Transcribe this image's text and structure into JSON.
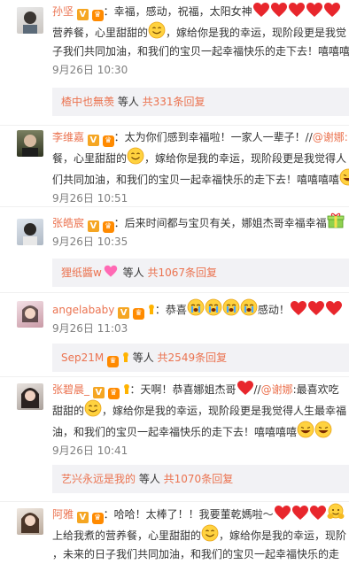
{
  "comments": [
    {
      "username": "孙坚",
      "lines": [
        "：幸福，感动，祝福，太阳女神",
        "营养餐，心里甜甜的",
        "，嫁给你是我的幸运，现阶段更是我觉",
        "子我们共同加油，和我们的宝贝一起幸福快乐的走下去！嘻嘻嘻"
      ],
      "time": "9月26日 10:30",
      "reply": {
        "who": "楂中也無羡",
        "middle": " 等人 ",
        "count": "共331条回复"
      }
    },
    {
      "username": "李维嘉",
      "lines": [
        "：太为你们感到幸福啦！一家人一辈子！//",
        "@谢娜:",
        "餐，心里甜甜的",
        "，嫁给你是我的幸运，现阶段更是我觉得人",
        "们共同加油，和我们的宝贝一起幸福快乐的走下去！嘻嘻嘻嘻"
      ],
      "time": "9月26日 10:51"
    },
    {
      "username": "张皓宸",
      "lines": [
        "：后来时间都与宝贝有关，娜姐杰哥幸福幸福"
      ],
      "time": "9月26日 10:35",
      "reply": {
        "who": "狸纸醬w",
        "middle": " 等人 ",
        "count": "共1067条回复"
      }
    },
    {
      "username": "angelababy",
      "lines": [
        "：恭喜",
        "感动！"
      ],
      "time": "9月26日 11:03",
      "reply": {
        "who": "Sep21M",
        "middle": " 等人 ",
        "count": "共2549条回复"
      }
    },
    {
      "username": "张碧晨_",
      "lines": [
        "：天啊！恭喜娜姐杰哥",
        "//",
        "@谢娜",
        ":最喜欢吃",
        "甜甜的",
        "，嫁给你是我的幸运，现阶段更是我觉得人生最幸福",
        "油，和我们的宝贝一起幸福快乐的走下去！嘻嘻嘻嘻"
      ],
      "time": "9月26日 10:41",
      "reply": {
        "who": "艺兴永远是我的",
        "middle": " 等人 ",
        "count": "共1070条回复"
      }
    },
    {
      "username": "阿雅",
      "lines": [
        "：哈哈！太棒了！！我要董乾媽啦～",
        "上给我煮的营养餐，心里甜甜的",
        "，嫁给你是我的幸运，现阶",
        "，未来的日子我们共同加油，和我们的宝贝一起幸福快乐的走"
      ]
    }
  ],
  "colors": {
    "link": "#eb7350",
    "time": "#808080",
    "reply_bg": "#f2f2f5",
    "text": "#333333"
  }
}
